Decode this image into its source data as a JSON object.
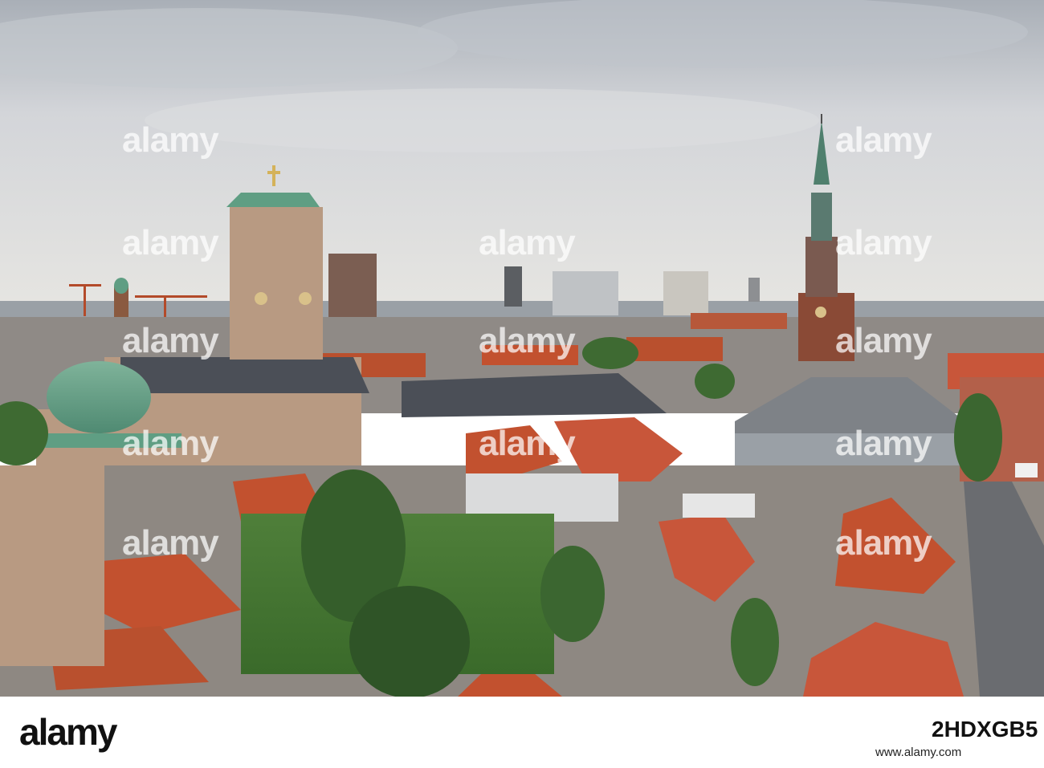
{
  "photo": {
    "subject": "copenhagen-skyline-rooftops",
    "sky_color": "#d9dade",
    "roof_red": "#c2512f",
    "copper_green": "#5f9e83"
  },
  "watermark": {
    "text": "alamy"
  },
  "footer": {
    "logo_text": "alamy",
    "image_id": "2HDXGB5",
    "site": "www.alamy.com"
  }
}
